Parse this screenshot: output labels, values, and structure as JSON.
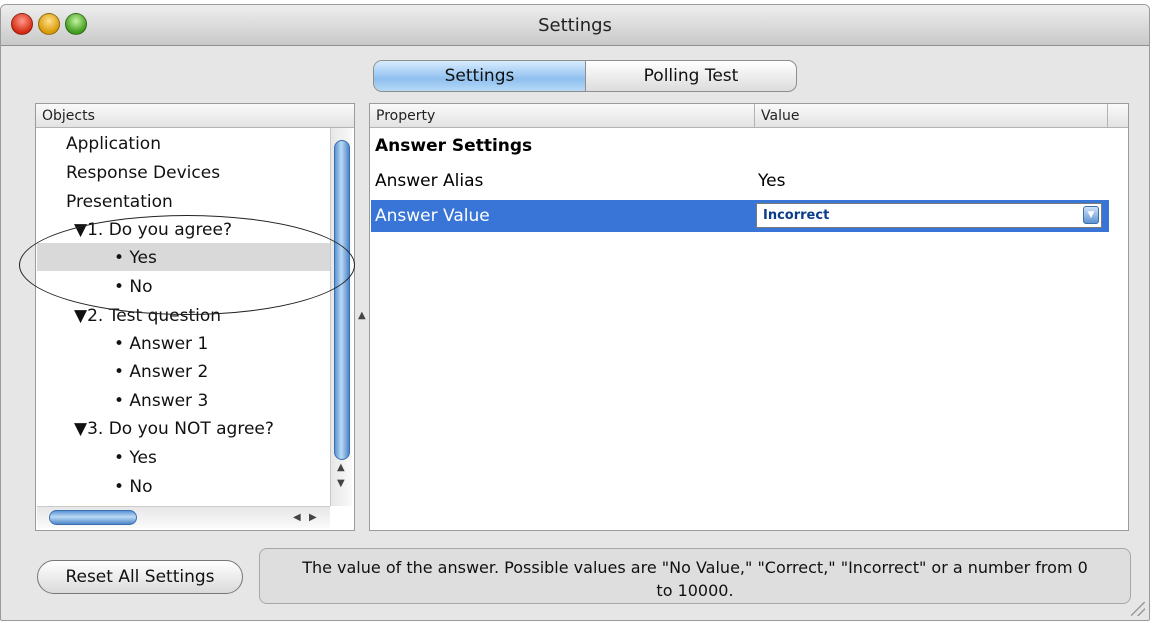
{
  "window": {
    "title": "Settings"
  },
  "tabs": [
    {
      "label": "Settings",
      "active": true
    },
    {
      "label": "Polling Test",
      "active": false
    }
  ],
  "objects": {
    "header": "Objects",
    "items": [
      {
        "text": "Application",
        "level": 0
      },
      {
        "text": "Response Devices",
        "level": 0
      },
      {
        "text": "Presentation",
        "level": 0
      },
      {
        "text": "▼1. Do you agree?",
        "level": 1
      },
      {
        "text": "• Yes",
        "level": 2,
        "selected": true
      },
      {
        "text": "• No",
        "level": 2
      },
      {
        "text": "▼2. Test question",
        "level": 1
      },
      {
        "text": "• Answer 1",
        "level": 2
      },
      {
        "text": "• Answer 2",
        "level": 2
      },
      {
        "text": "• Answer 3",
        "level": 2
      },
      {
        "text": "▼3. Do you NOT agree?",
        "level": 1
      },
      {
        "text": "• Yes",
        "level": 2
      },
      {
        "text": "• No",
        "level": 2
      }
    ]
  },
  "properties": {
    "headers": [
      "Property",
      "Value"
    ],
    "rows": [
      {
        "property": "Answer Settings",
        "value": "",
        "bold": true
      },
      {
        "property": "Answer Alias",
        "value": "Yes"
      },
      {
        "property": "Answer Value",
        "value": "Incorrect",
        "selected": true,
        "editor": "dropdown"
      }
    ]
  },
  "footer": {
    "reset_label": "Reset All Settings",
    "help_text": "The value of the answer. Possible values are \"No Value,\" \"Correct,\" \"Incorrect\" or a number from 0 to 10000."
  },
  "colors": {
    "selection_blue": "#3875d7",
    "tab_active": "#8fc0ef",
    "window_bg": "#e6e6e6"
  }
}
